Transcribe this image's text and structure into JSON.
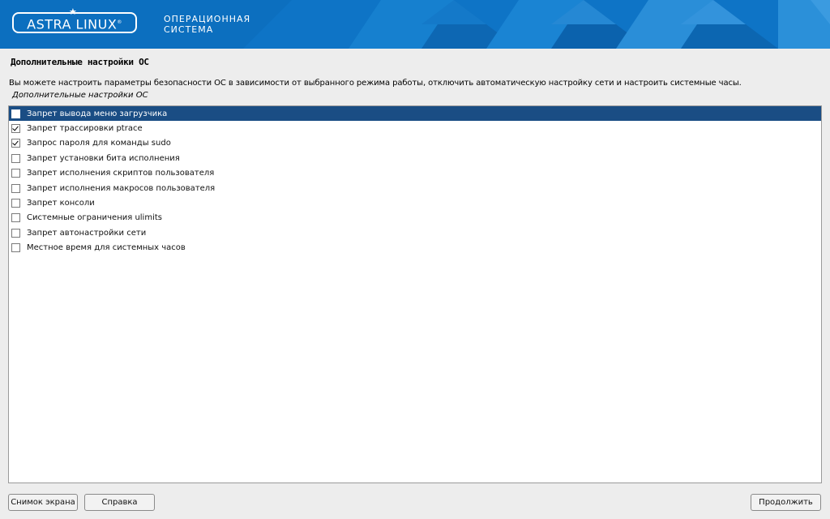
{
  "header": {
    "logo_text": "ASTRA LINUX",
    "logo_mark": "®",
    "star_icon": "star-icon",
    "subtitle_line1": "ОПЕРАЦИОННАЯ",
    "subtitle_line2": "СИСТЕМА",
    "colors": {
      "banner": "#0c6fbf",
      "banner_dark": "#0a5aa0",
      "banner_light": "#2d8ad6"
    }
  },
  "page": {
    "title": "Дополнительные настройки ОС",
    "description": "Вы можете настроить параметры безопасности ОС в зависимости от выбранного режима работы, отключить автоматическую настройку сети и настроить системные часы.",
    "list_caption": "Дополнительные настройки ОС"
  },
  "options": [
    {
      "label": "Запрет вывода меню загрузчика",
      "checked": false,
      "selected": true
    },
    {
      "label": "Запрет трассировки ptrace",
      "checked": true,
      "selected": false
    },
    {
      "label": "Запрос пароля для команды sudo",
      "checked": true,
      "selected": false
    },
    {
      "label": "Запрет установки бита исполнения",
      "checked": false,
      "selected": false
    },
    {
      "label": "Запрет исполнения скриптов пользователя",
      "checked": false,
      "selected": false
    },
    {
      "label": "Запрет исполнения макросов пользователя",
      "checked": false,
      "selected": false
    },
    {
      "label": "Запрет консоли",
      "checked": false,
      "selected": false
    },
    {
      "label": "Системные ограничения ulimits",
      "checked": false,
      "selected": false
    },
    {
      "label": "Запрет автонастройки сети",
      "checked": false,
      "selected": false
    },
    {
      "label": "Местное время для системных часов",
      "checked": false,
      "selected": false
    }
  ],
  "buttons": {
    "screenshot": "Снимок экрана",
    "help": "Справка",
    "continue": "Продолжить"
  },
  "colors": {
    "selection": "#1a4d84",
    "background": "#ededed"
  }
}
